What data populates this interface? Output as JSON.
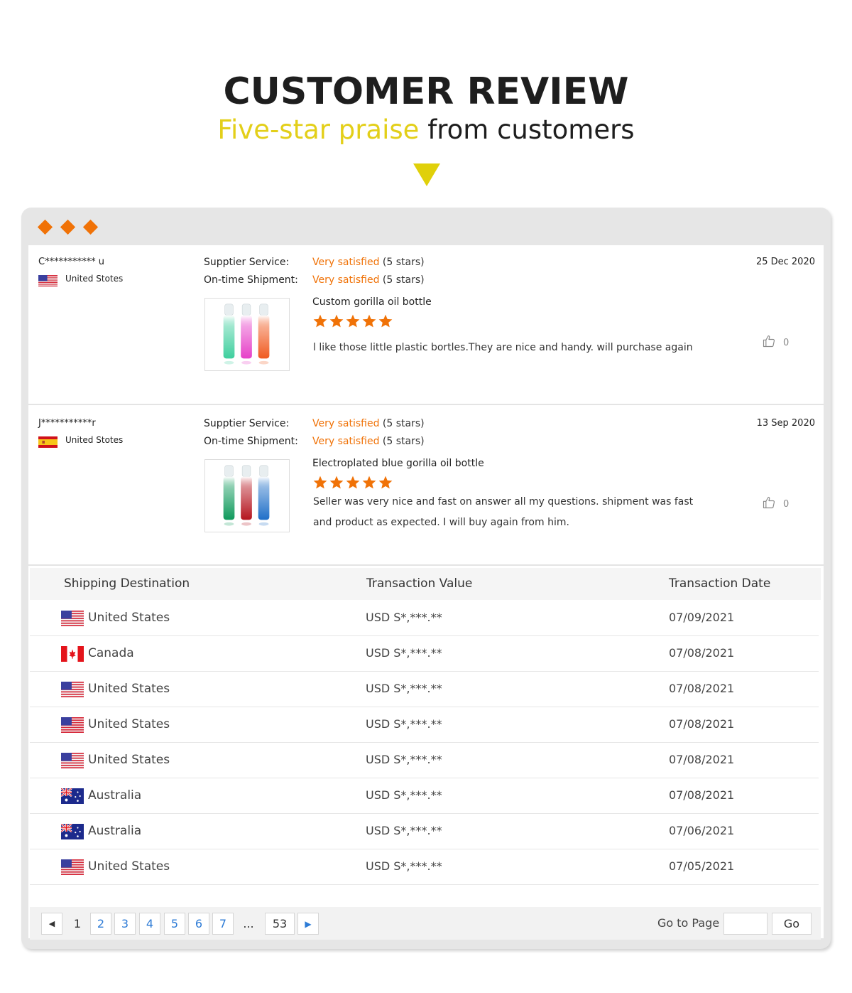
{
  "header": {
    "title": "CUSTOMER REVIEW",
    "subtitle_accent": "Five-star praise",
    "subtitle_rest": " from customers"
  },
  "colors": {
    "accent_orange": "#f07207",
    "accent_yellow": "#e3cf19",
    "link_blue": "#2d7bd6"
  },
  "reviews": [
    {
      "name": "C*********** u",
      "flag": "us",
      "country": "United Stotes",
      "date": "25 Dec 2020",
      "service_label": "Supptier Service:",
      "service_rating": "Very satisfied",
      "service_stars": "(5 stars)",
      "shipment_label": "On-time Shipment:",
      "shipment_rating": "Very satisfied",
      "shipment_stars": "(5 stars)",
      "product": "Custom gorilla oil bottle",
      "stars": 5,
      "text": "l like those little plastic bortles.They are nice and handy. will purchase again",
      "likes": "0",
      "thumb_colors": [
        "#3ecf9e",
        "#e640c8",
        "#f05a20"
      ]
    },
    {
      "name": "J***********r",
      "flag": "es",
      "country": "United Stotes",
      "date": "13 Sep 2020",
      "service_label": "Supptier Service:",
      "service_rating": "Very satisfied",
      "service_stars": "(5 stars)",
      "shipment_label": "On-time Shipment:",
      "shipment_rating": "Very satisfied",
      "shipment_stars": "(5 stars)",
      "product": "Electroplated blue gorilla oil bottle",
      "stars": 5,
      "text": "Seller was very nice and fast on answer all my questions. shipment was fast and product as expected. I will buy again from him.",
      "likes": "0",
      "thumb_colors": [
        "#0f9a5c",
        "#b5141e",
        "#1f6fc8"
      ]
    }
  ],
  "shipping": {
    "columns": [
      "Shipping Destination",
      "Transaction Value",
      "Transaction Date"
    ],
    "rows": [
      {
        "flag": "us",
        "country": "United States",
        "value": "USD S*,***.**",
        "date": "07/09/2021"
      },
      {
        "flag": "ca",
        "country": "Canada",
        "value": "USD S*,***.**",
        "date": "07/08/2021"
      },
      {
        "flag": "us",
        "country": "United States",
        "value": "USD S*,***.**",
        "date": "07/08/2021"
      },
      {
        "flag": "us",
        "country": "United States",
        "value": "USD S*,***.**",
        "date": "07/08/2021"
      },
      {
        "flag": "us",
        "country": "United States",
        "value": "USD S*,***.**",
        "date": "07/08/2021"
      },
      {
        "flag": "au",
        "country": "Australia",
        "value": "USD S*,***.**",
        "date": "07/08/2021"
      },
      {
        "flag": "au",
        "country": "Australia",
        "value": "USD S*,***.**",
        "date": "07/06/2021"
      },
      {
        "flag": "us",
        "country": "United States",
        "value": "USD S*,***.**",
        "date": "07/05/2021"
      }
    ]
  },
  "pagination": {
    "prev": "◀",
    "current": "1",
    "pages": [
      "2",
      "3",
      "4",
      "5",
      "6",
      "7"
    ],
    "ellipsis": "...",
    "last": "53",
    "next": "▶",
    "goto_label": "Go to Page",
    "goto_value": "",
    "go_button": "Go"
  }
}
